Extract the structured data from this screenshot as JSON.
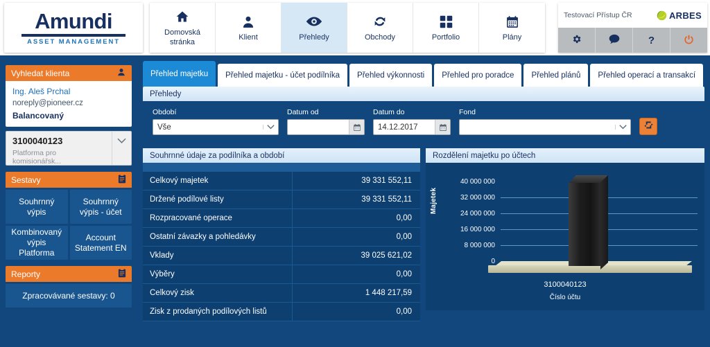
{
  "brand": {
    "name": "Amundi",
    "tagline": "ASSET MANAGEMENT",
    "partner": "ARBES"
  },
  "topnav": {
    "items": [
      {
        "label": "Domovská stránka",
        "icon": "home-icon",
        "active": false
      },
      {
        "label": "Klient",
        "icon": "person-icon",
        "active": false
      },
      {
        "label": "Přehledy",
        "icon": "eye-icon",
        "active": true
      },
      {
        "label": "Obchody",
        "icon": "refresh-icon",
        "active": false
      },
      {
        "label": "Portfolio",
        "icon": "grid-icon",
        "active": false
      },
      {
        "label": "Plány",
        "icon": "calendar-icon",
        "active": false
      }
    ],
    "user_label": "Testovací Přístup ČR",
    "util_buttons": [
      {
        "name": "settings-button",
        "icon": "gear-icon"
      },
      {
        "name": "messages-button",
        "icon": "chat-icon"
      },
      {
        "name": "help-button",
        "icon": "question-icon"
      },
      {
        "name": "logout-button",
        "icon": "power-icon"
      }
    ]
  },
  "sidebar": {
    "search_client": {
      "title": "Vyhledat klienta",
      "icon": "person-search-icon"
    },
    "client": {
      "name": "Ing. Aleš Prchal",
      "email": "noreply@pioneer.cz",
      "strategy": "Balancovaný"
    },
    "account_select": {
      "number": "3100040123",
      "description": "Platforma pro komisionářsk..."
    },
    "reports_section": {
      "title": "Sestavy",
      "icon": "clipboard-icon",
      "buttons": [
        "Souhrnný výpis",
        "Souhrnný výpis - účet",
        "Kombinovaný výpis Platforma",
        "Account Statement EN"
      ]
    },
    "reporty_section": {
      "title": "Reporty",
      "icon": "clipboard-icon",
      "status": "Zpracovávané sestavy: 0"
    }
  },
  "tabs": [
    {
      "label": "Přehled majetku",
      "active": true
    },
    {
      "label": "Přehled majetku - účet podílníka",
      "active": false
    },
    {
      "label": "Přehled výkonnosti",
      "active": false
    },
    {
      "label": "Přehled pro poradce",
      "active": false
    },
    {
      "label": "Přehled plánů",
      "active": false
    },
    {
      "label": "Přehled operací a transakcí",
      "active": false
    }
  ],
  "overview_panel": {
    "title": "Přehledy"
  },
  "filters": {
    "period": {
      "label": "Období",
      "value": "Vše"
    },
    "date_from": {
      "label": "Datum od",
      "value": ""
    },
    "date_to": {
      "label": "Datum do",
      "value": "14.12.2017"
    },
    "fund": {
      "label": "Fond",
      "value": ""
    },
    "refresh_button": "refresh-icon"
  },
  "summary_table": {
    "title": "Souhrnné údaje za podílníka a období",
    "rows": [
      {
        "label": "Celkový majetek",
        "value": "39 331 552,11"
      },
      {
        "label": "Držené podílové listy",
        "value": "39 331 552,11"
      },
      {
        "label": "Rozpracované operace",
        "value": "0,00"
      },
      {
        "label": "Ostatní závazky a pohledávky",
        "value": "0,00"
      },
      {
        "label": "Vklady",
        "value": "39 025 621,02"
      },
      {
        "label": "Výběry",
        "value": "0,00"
      },
      {
        "label": "Celkový zisk",
        "value": "1 448 217,59"
      },
      {
        "label": "Zisk z prodaných podílových listů",
        "value": "0,00"
      }
    ]
  },
  "chart_panel": {
    "title": "Rozdělení majetku po účtech"
  },
  "chart_data": {
    "type": "bar",
    "title": "Rozdělení majetku po účtech",
    "categories": [
      "3100040123"
    ],
    "values": [
      39331552.11
    ],
    "xlabel": "Číslo účtu",
    "ylabel": "Majetek",
    "ylim": [
      0,
      40000000
    ],
    "yticks": [
      0,
      8000000,
      16000000,
      24000000,
      32000000,
      40000000
    ],
    "ytick_labels": [
      "0",
      "8 000 000",
      "16 000 000",
      "24 000 000",
      "32 000 000",
      "40 000 000"
    ],
    "grid": true,
    "legend": false
  },
  "colors": {
    "brand_navy": "#17305f",
    "accent_orange": "#ec7a2b",
    "panel_blue": "#11477c",
    "active_tab": "#1c8ad4",
    "table_bg": "#0d3f71"
  }
}
